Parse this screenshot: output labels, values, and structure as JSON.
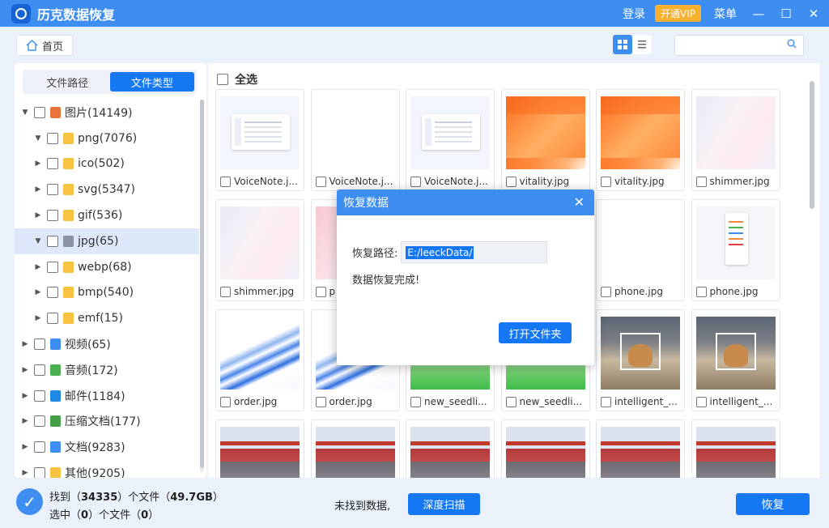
{
  "titlebar": {
    "app_title": "历克数据恢复",
    "login": "登录",
    "vip": "开通VIP",
    "menu": "菜单",
    "minimize": "—",
    "maximize": "☐",
    "close": "✕"
  },
  "toolbar": {
    "home": "首页",
    "search": {
      "placeholder": "",
      "value": ""
    }
  },
  "sidebar": {
    "tabs": [
      {
        "label": "文件路径",
        "active": false
      },
      {
        "label": "文件类型",
        "active": true
      }
    ],
    "tree": [
      {
        "label": "图片(14149)",
        "expanded": true,
        "icon": "image-icon",
        "icon_color": "#e8743b"
      },
      {
        "label": "png(7076)",
        "expanded": true,
        "icon": "folder-icon",
        "icon_color": "#f5c242"
      },
      {
        "label": "ico(502)",
        "expanded": false,
        "icon": "folder-icon",
        "icon_color": "#f5c242"
      },
      {
        "label": "svg(5347)",
        "expanded": false,
        "icon": "folder-icon",
        "icon_color": "#f5c242"
      },
      {
        "label": "gif(536)",
        "expanded": false,
        "icon": "folder-icon",
        "icon_color": "#f5c242"
      },
      {
        "label": "jpg(65)",
        "expanded": true,
        "icon": "folder-icon",
        "icon_color": "#8a94a6",
        "selected": true
      },
      {
        "label": "webp(68)",
        "expanded": false,
        "icon": "folder-icon",
        "icon_color": "#f5c242"
      },
      {
        "label": "bmp(540)",
        "expanded": false,
        "icon": "folder-icon",
        "icon_color": "#f5c242"
      },
      {
        "label": "emf(15)",
        "expanded": false,
        "icon": "folder-icon",
        "icon_color": "#f5c242"
      },
      {
        "label": "视频(65)",
        "expanded": false,
        "icon": "video-icon",
        "icon_color": "#3d8ef0"
      },
      {
        "label": "音频(172)",
        "expanded": false,
        "icon": "music-icon",
        "icon_color": "#4caf50"
      },
      {
        "label": "邮件(1184)",
        "expanded": false,
        "icon": "mail-icon",
        "icon_color": "#1e88e5"
      },
      {
        "label": "压缩文档(177)",
        "expanded": false,
        "icon": "archive-icon",
        "icon_color": "#43a047"
      },
      {
        "label": "文档(9283)",
        "expanded": false,
        "icon": "document-icon",
        "icon_color": "#3d8ef0"
      },
      {
        "label": "其他(9205)",
        "expanded": false,
        "icon": "other-icon",
        "icon_color": "#f5c242"
      }
    ]
  },
  "main": {
    "select_all": "全选",
    "files": [
      {
        "name": "VoiceNote.j...",
        "thumb": "ui"
      },
      {
        "name": "VoiceNote.j...",
        "thumb": "white"
      },
      {
        "name": "VoiceNote.j...",
        "thumb": "ui"
      },
      {
        "name": "vitality.jpg",
        "thumb": "vital"
      },
      {
        "name": "vitality.jpg",
        "thumb": "vital"
      },
      {
        "name": "shimmer.jpg",
        "thumb": "shimmer"
      },
      {
        "name": "shimmer.jpg",
        "thumb": "shimmer"
      },
      {
        "name": "p",
        "thumb": "shimmer2"
      },
      {
        "name": "",
        "thumb": "white"
      },
      {
        "name": "",
        "thumb": "white"
      },
      {
        "name": "phone.jpg",
        "thumb": "white"
      },
      {
        "name": "phone.jpg",
        "thumb": "phone"
      },
      {
        "name": "order.jpg",
        "thumb": "order"
      },
      {
        "name": "order.jpg",
        "thumb": "order"
      },
      {
        "name": "new_seedli...",
        "thumb": "green"
      },
      {
        "name": "new_seedli...",
        "thumb": "green"
      },
      {
        "name": "intelligent_...",
        "thumb": "cat"
      },
      {
        "name": "intelligent_...",
        "thumb": "cat"
      },
      {
        "name": "",
        "thumb": "street"
      },
      {
        "name": "",
        "thumb": "street"
      },
      {
        "name": "",
        "thumb": "street"
      },
      {
        "name": "",
        "thumb": "street"
      },
      {
        "name": "",
        "thumb": "street"
      },
      {
        "name": "",
        "thumb": "street"
      }
    ]
  },
  "dialog": {
    "title": "恢复数据",
    "path_label": "恢复路径:",
    "path_value": "E:/leeckData/",
    "message": "数据恢复完成!",
    "open_folder": "打开文件夹"
  },
  "status": {
    "found_prefix": "找到（",
    "found_count": "34335",
    "found_mid": "）个文件（",
    "found_size": "49.7GB",
    "found_suffix": "）",
    "selected_prefix": "选中（",
    "selected_count": "0",
    "selected_mid": "）个文件（",
    "selected_size": "0",
    "selected_suffix": "）",
    "not_found": "未找到数据,",
    "deep_scan": "深度扫描",
    "recover": "恢复"
  },
  "colors": {
    "accent": "#3d8ef0",
    "primary_button": "#1677f3",
    "vip": "#f7b030"
  }
}
